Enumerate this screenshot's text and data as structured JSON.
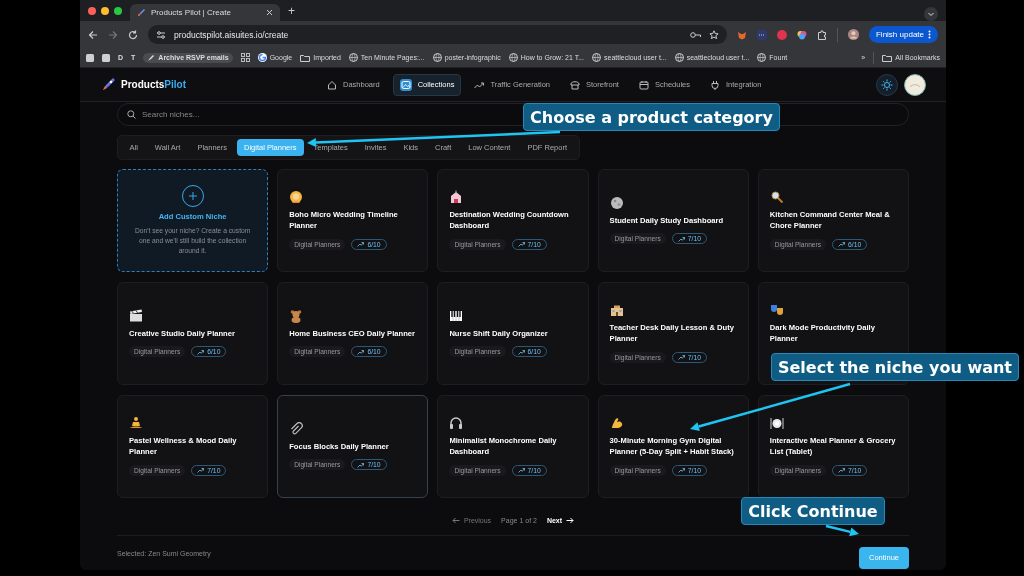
{
  "browser": {
    "tab_title": "Products Pilot | Create",
    "new_tab": "+",
    "url": "productspilot.aisuites.io/create",
    "update_button": "Finish update",
    "bookmarks": [
      {
        "kind": "square"
      },
      {
        "kind": "square"
      },
      {
        "kind": "letter",
        "label": "D"
      },
      {
        "kind": "letter",
        "label": "T"
      },
      {
        "kind": "bold",
        "label": "Archive RSVP emails"
      },
      {
        "kind": "apps"
      },
      {
        "kind": "google",
        "label": "Google"
      },
      {
        "kind": "folder",
        "label": "Imported"
      },
      {
        "kind": "page",
        "label": "Ten Minute Pages:..."
      },
      {
        "kind": "page",
        "label": "poster-infographic"
      },
      {
        "kind": "page",
        "label": "How to Grow: 21 T..."
      },
      {
        "kind": "page",
        "label": "seattlecloud user t..."
      },
      {
        "kind": "page",
        "label": "seattlecloud user t..."
      },
      {
        "kind": "page",
        "label": "Fount"
      }
    ],
    "more": "»",
    "all_bookmarks": "All Bookmarks"
  },
  "app": {
    "logo": {
      "part_1": "Products",
      "part_2": "Pilot"
    },
    "nav": [
      {
        "label": "Dashboard",
        "selected": false
      },
      {
        "label": "Collections",
        "selected": true
      },
      {
        "label": "Traffic Generation",
        "selected": false
      },
      {
        "label": "Storefront",
        "selected": false
      },
      {
        "label": "Schedules",
        "selected": false
      },
      {
        "label": "Integration",
        "selected": false
      }
    ]
  },
  "search": {
    "placeholder": "Search niches..."
  },
  "categories": [
    {
      "label": "All",
      "selected": false
    },
    {
      "label": "Wall Art",
      "selected": false
    },
    {
      "label": "Planners",
      "selected": false
    },
    {
      "label": "Digital Planners",
      "selected": true
    },
    {
      "label": "Templates",
      "selected": false
    },
    {
      "label": "Invites",
      "selected": false
    },
    {
      "label": "Kids",
      "selected": false
    },
    {
      "label": "Craft",
      "selected": false
    },
    {
      "label": "Low Content",
      "selected": false
    },
    {
      "label": "PDF Report",
      "selected": false
    }
  ],
  "custom_niche": {
    "title": "Add Custom Niche",
    "description": "Don't see your niche? Create a custom one and we'll still build the collection around it."
  },
  "niches": [
    {
      "title": "Boho Micro Wedding Timeline Planner",
      "category": "Digital Planners",
      "score": "6/10",
      "highlighted": false
    },
    {
      "title": "Destination Wedding Countdown Dashboard",
      "category": "Digital Planners",
      "score": "7/10",
      "highlighted": false
    },
    {
      "title": "Student Daily Study Dashboard",
      "category": "Digital Planners",
      "score": "7/10",
      "highlighted": false
    },
    {
      "title": "Kitchen Command Center Meal & Chore Planner",
      "category": "Digital Planners",
      "score": "6/10",
      "highlighted": false
    },
    {
      "title": "Creative Studio Daily Planner",
      "category": "Digital Planners",
      "score": "6/10",
      "highlighted": false
    },
    {
      "title": "Home Business CEO Daily Planner",
      "category": "Digital Planners",
      "score": "6/10",
      "highlighted": false
    },
    {
      "title": "Nurse Shift Daily Organizer",
      "category": "Digital Planners",
      "score": "6/10",
      "highlighted": false
    },
    {
      "title": "Teacher Desk Daily Lesson & Duty Planner",
      "category": "Digital Planners",
      "score": "7/10",
      "highlighted": false
    },
    {
      "title": "Dark Mode Productivity Daily Planner",
      "highlighted": false
    },
    {
      "title": "Pastel Wellness & Mood Daily Planner",
      "category": "Digital Planners",
      "score": "7/10",
      "highlighted": false
    },
    {
      "title": "Focus Blocks Daily Planner",
      "category": "Digital Planners",
      "score": "7/10",
      "highlighted": true
    },
    {
      "title": "Minimalist Monochrome Daily Dashboard",
      "category": "Digital Planners",
      "score": "7/10",
      "highlighted": false
    },
    {
      "title": "30-Minute Morning Gym Digital Planner (5-Day Split + Habit Stack)",
      "category": "Digital Planners",
      "score": "7/10",
      "highlighted": false
    },
    {
      "title": "Interactive Meal Planner & Grocery List (Tablet)",
      "category": "Digital Planners",
      "score": "7/10",
      "highlighted": false
    }
  ],
  "pagination": {
    "previous": "Previous",
    "page": "Page 1 of 2",
    "next": "Next"
  },
  "footer": {
    "selected": "Selected: Zen Sumi Geometry",
    "continue": "Continue"
  },
  "annotations": [
    {
      "text": "Choose a product category"
    },
    {
      "text": "Select the niche you want"
    },
    {
      "text": "Click Continue"
    }
  ]
}
